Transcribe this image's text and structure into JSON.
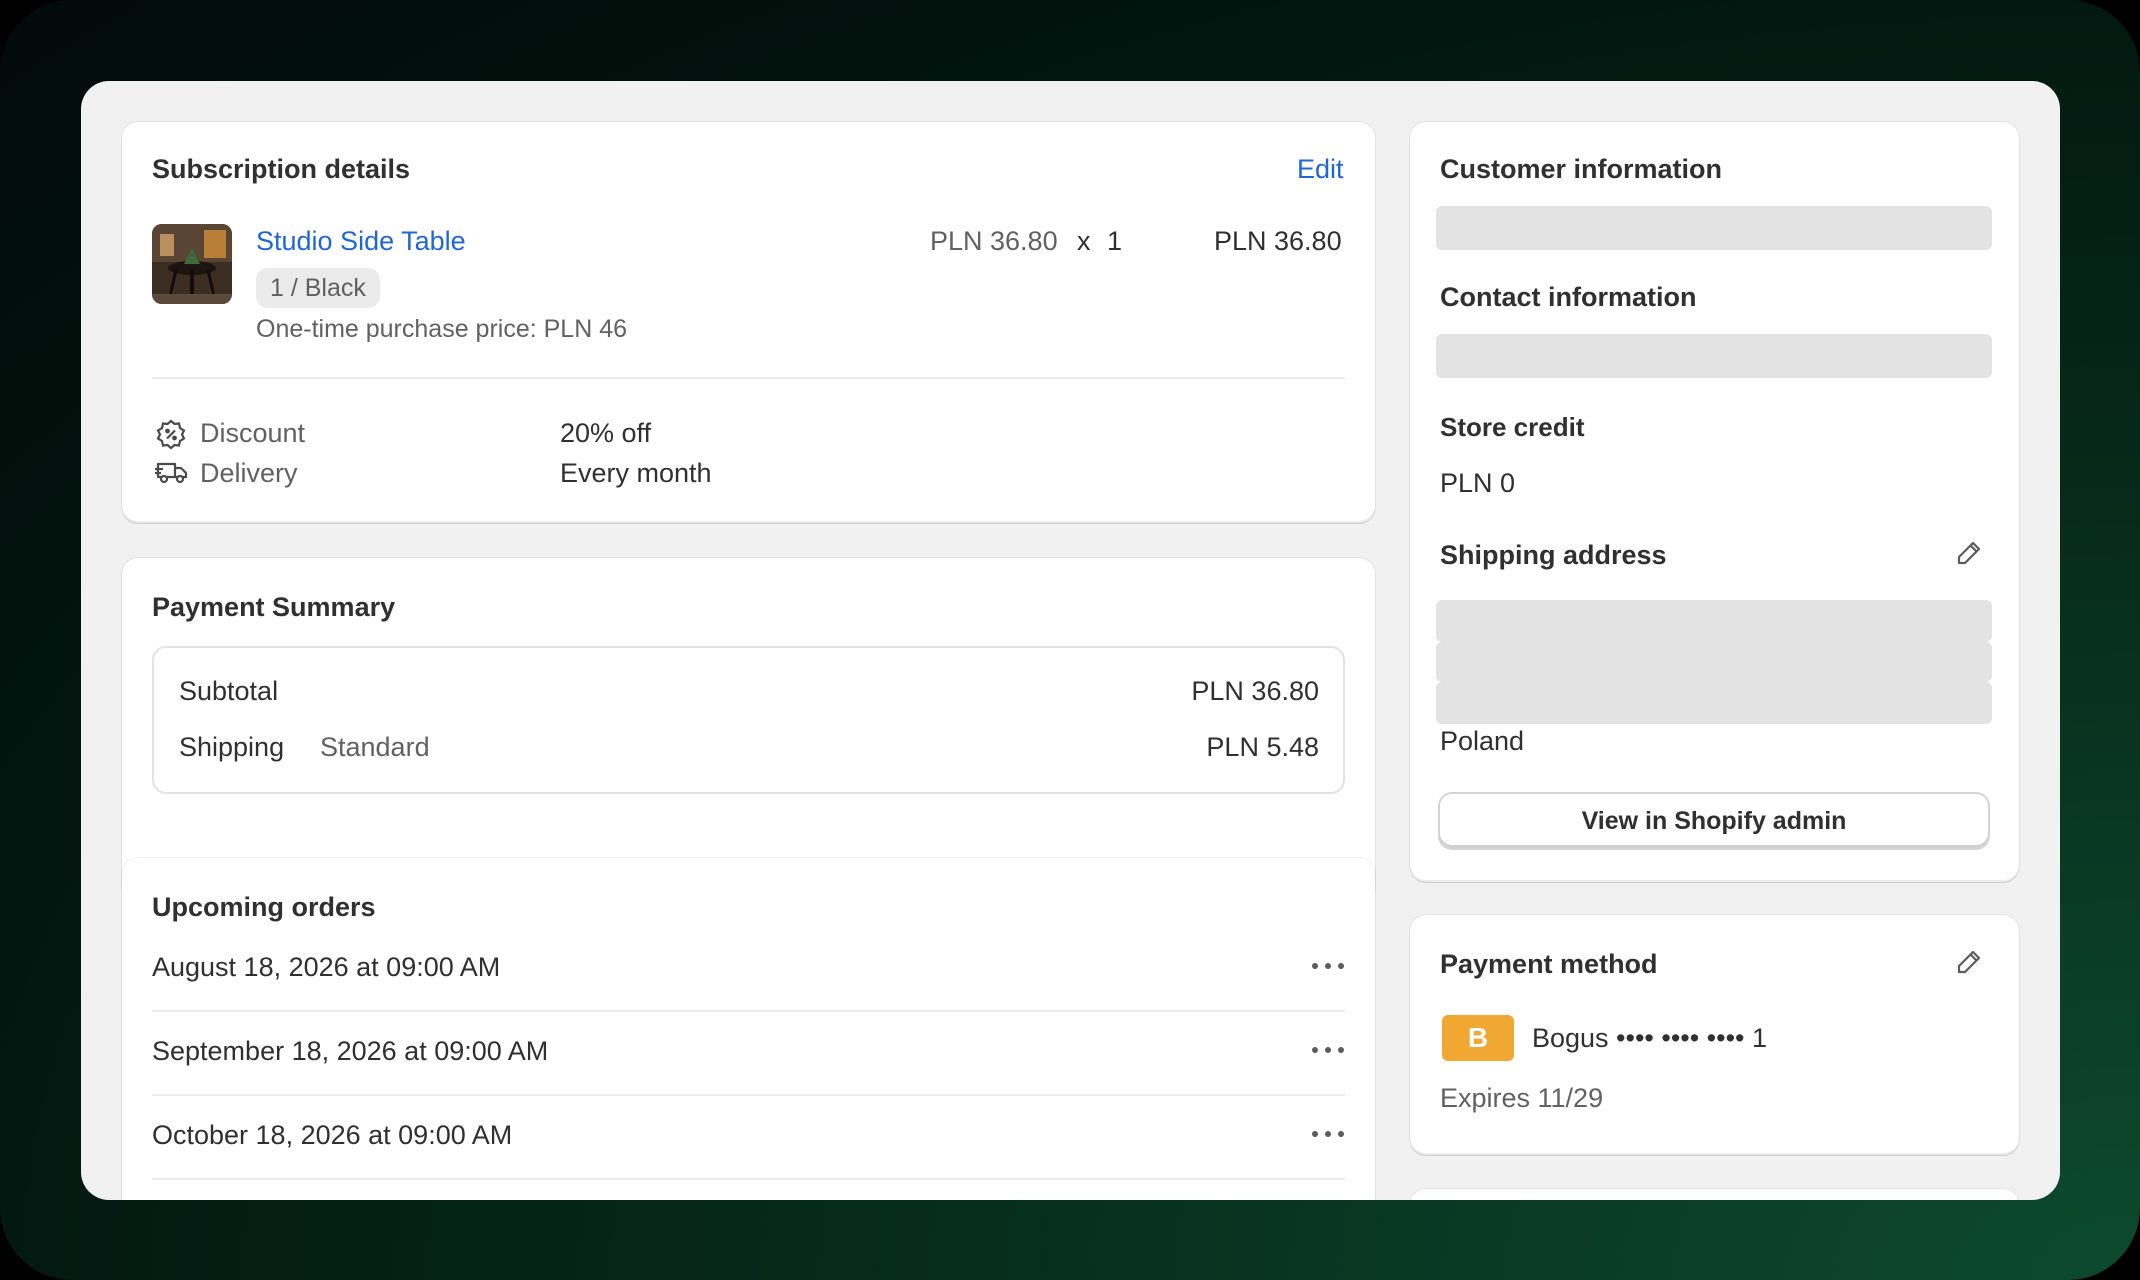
{
  "subscription": {
    "title": "Subscription details",
    "edit_label": "Edit",
    "product": {
      "name": "Studio Side Table",
      "variant": "1 / Black",
      "one_time_price": "One-time purchase price: PLN 46",
      "unit_price": "PLN 36.80",
      "times": "x",
      "quantity": "1",
      "line_total": "PLN 36.80",
      "image_icon": "product-thumbnail"
    },
    "discount": {
      "label": "Discount",
      "value": "20% off",
      "icon": "discount-icon"
    },
    "delivery": {
      "label": "Delivery",
      "value": "Every month",
      "icon": "delivery-truck-icon"
    }
  },
  "payment_summary": {
    "title": "Payment Summary",
    "subtotal_label": "Subtotal",
    "subtotal_value": "PLN 36.80",
    "shipping_label": "Shipping",
    "shipping_method": "Standard",
    "shipping_value": "PLN 5.48"
  },
  "upcoming_orders": {
    "title": "Upcoming orders",
    "items": [
      {
        "date": "August 18, 2026 at 09:00 AM"
      },
      {
        "date": "September 18, 2026 at 09:00 AM"
      },
      {
        "date": "October 18, 2026 at 09:00 AM"
      }
    ]
  },
  "customer": {
    "title": "Customer information",
    "contact_title": "Contact information",
    "store_credit_title": "Store credit",
    "store_credit_value": "PLN 0",
    "shipping_title": "Shipping address",
    "country": "Poland",
    "admin_button": "View in Shopify admin"
  },
  "payment_method": {
    "title": "Payment method",
    "brand_letter": "B",
    "card_label": "Bogus •••• •••• •••• 1",
    "expires": "Expires 11/29",
    "brand_color": "#f0a832"
  },
  "colors": {
    "accent_link": "#1f66d6",
    "background": "#f1f1f1",
    "skeleton": "#e3e3e3"
  }
}
